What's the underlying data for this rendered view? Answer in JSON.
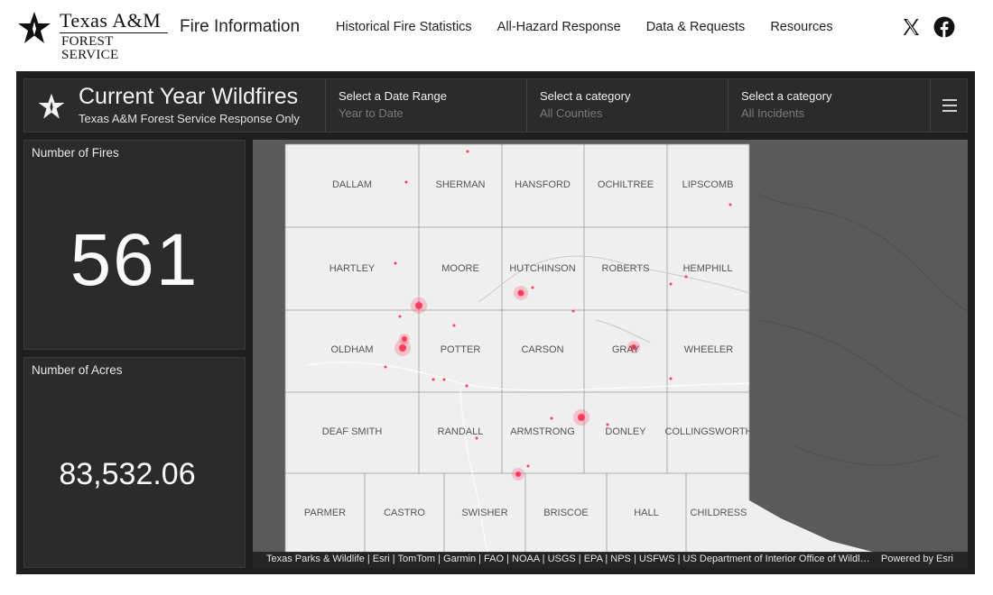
{
  "brand": {
    "logo_line1": "Texas A&M",
    "logo_line2": "Forest Service",
    "site_title": "Fire Information"
  },
  "nav": [
    "Historical Fire Statistics",
    "All-Hazard Response",
    "Data & Requests",
    "Resources"
  ],
  "social": [
    "x-icon",
    "facebook-icon"
  ],
  "dashboard": {
    "title": "Current Year Wildfires",
    "subtitle": "Texas A&M Forest Service Response Only",
    "selectors": [
      {
        "label": "Select a Date Range",
        "value": "Year to Date"
      },
      {
        "label": "Select a category",
        "value": "All Counties"
      },
      {
        "label": "Select a category",
        "value": "All Incidents"
      }
    ],
    "fires": {
      "label": "Number of Fires",
      "value": "561"
    },
    "acres": {
      "label": "Number of Acres",
      "value": "83,532.06"
    },
    "map": {
      "counties": [
        "DALLAM",
        "SHERMAN",
        "HANSFORD",
        "OCHILTREE",
        "LIPSCOMB",
        "HARTLEY",
        "MOORE",
        "HUTCHINSON",
        "ROBERTS",
        "HEMPHILL",
        "OLDHAM",
        "POTTER",
        "CARSON",
        "GRAY",
        "WHEELER",
        "DEAF SMITH",
        "RANDALL",
        "ARMSTRONG",
        "DONLEY",
        "COLLINGSWORTH",
        "PARMER",
        "CASTRO",
        "SWISHER",
        "BRISCOE",
        "HALL",
        "CHILDRESS"
      ],
      "attribution": "Texas Parks & Wildlife | Esri | TomTom | Garmin | FAO | NOAA | USGS | EPA | NPS | USFWS | US Department of Interior Office of Wildland Fire",
      "powered_by": "Powered by Esri"
    }
  },
  "colors": {
    "fire_dot": "#ff3b5c",
    "panel_bg": "#2b2b2b",
    "dash_bg": "#1f1f1f"
  }
}
